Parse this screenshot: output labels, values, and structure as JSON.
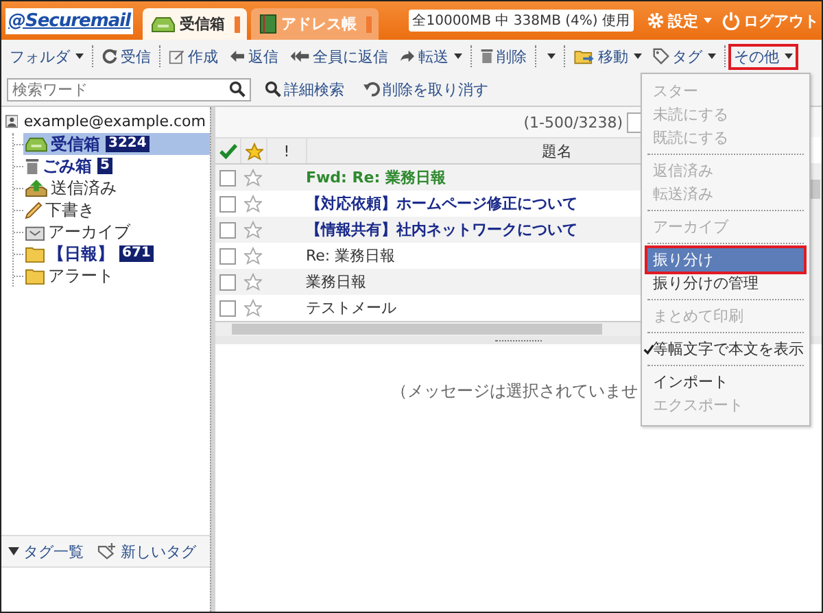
{
  "header": {
    "logo": "@Securemail",
    "tabs": [
      {
        "label": "受信箱",
        "kind": "inbox",
        "selected": true
      },
      {
        "label": "アドレス帳",
        "kind": "addressbook",
        "selected": false
      }
    ],
    "storage": "全10000MB 中 338MB (4%) 使用",
    "settings": "設定",
    "logout": "ログアウト"
  },
  "toolbar": [
    [
      {
        "label": "フォルダ",
        "kind": "plain",
        "dropdown": true,
        "highlighted": false
      }
    ],
    [
      {
        "label": "受信",
        "kind": "receive",
        "dropdown": false,
        "highlighted": false
      }
    ],
    [
      {
        "label": "作成",
        "kind": "compose",
        "dropdown": false,
        "highlighted": false
      },
      {
        "label": "返信",
        "kind": "reply",
        "dropdown": false,
        "highlighted": false
      },
      {
        "label": "全員に返信",
        "kind": "replyall",
        "dropdown": false,
        "highlighted": false
      },
      {
        "label": "転送",
        "kind": "forward",
        "dropdown": true,
        "highlighted": false
      }
    ],
    [
      {
        "label": "削除",
        "kind": "delete",
        "dropdown": false,
        "highlighted": false
      }
    ],
    [
      {
        "kind": "plain",
        "dropdown": true,
        "highlighted": false
      }
    ],
    [
      {
        "label": "移動",
        "kind": "move",
        "dropdown": true,
        "highlighted": false
      },
      {
        "label": "タグ",
        "kind": "tag",
        "dropdown": true,
        "highlighted": false
      }
    ],
    [
      {
        "label": "その他",
        "kind": "plain",
        "dropdown": true,
        "highlighted": true
      }
    ]
  ],
  "search": {
    "placeholder": "検索ワード",
    "advanced": "詳細検索",
    "undo": "削除を取り消す"
  },
  "sidebar": {
    "account": "example@example.com",
    "folders": [
      {
        "name": "受信箱",
        "kind": "inbox",
        "count": "3224",
        "selected": true
      },
      {
        "name": "ごみ箱",
        "kind": "trash",
        "count": "5",
        "selected": false
      },
      {
        "name": "送信済み",
        "kind": "sent",
        "selected": false
      },
      {
        "name": "下書き",
        "kind": "drafts",
        "selected": false
      },
      {
        "name": "アーカイブ",
        "kind": "archive",
        "selected": false
      },
      {
        "name": "【日報】",
        "kind": "folder",
        "count": "671",
        "selected": false
      },
      {
        "name": "アラート",
        "kind": "folder",
        "selected": false
      }
    ],
    "tag_list": "タグ一覧",
    "new_tag": "新しいタグ"
  },
  "messages": {
    "range": "(1-500/3238)",
    "columns": [
      "!",
      "題名"
    ],
    "rows": [
      {
        "subject": "Fwd: Re: 業務日報",
        "kind": "forwarded",
        "checked": false,
        "starred": false
      },
      {
        "subject": "【対応依頼】ホームページ修正について",
        "kind": "unread",
        "checked": false,
        "starred": false
      },
      {
        "subject": "【情報共有】社内ネットワークについて",
        "kind": "unread",
        "checked": false,
        "starred": false
      },
      {
        "subject": "Re: 業務日報",
        "kind": "read",
        "checked": false,
        "starred": false
      },
      {
        "subject": "業務日報",
        "kind": "read",
        "checked": false,
        "starred": false
      },
      {
        "subject": "テストメール",
        "kind": "read",
        "checked": false,
        "starred": false
      }
    ]
  },
  "preview": {
    "message": "（メッセージは選択されていませ"
  },
  "menu": {
    "groups": [
      [
        {
          "label": "スター",
          "disabled": true,
          "selected": false,
          "checked": false
        },
        {
          "label": "未読にする",
          "disabled": true,
          "selected": false,
          "checked": false
        },
        {
          "label": "既読にする",
          "disabled": true,
          "selected": false,
          "checked": false
        }
      ],
      [
        {
          "label": "返信済み",
          "disabled": true,
          "selected": false,
          "checked": false
        },
        {
          "label": "転送済み",
          "disabled": true,
          "selected": false,
          "checked": false
        }
      ],
      [
        {
          "label": "アーカイブ",
          "disabled": true,
          "selected": false,
          "checked": false
        }
      ],
      [
        {
          "label": "振り分け",
          "disabled": false,
          "selected": true,
          "checked": false
        },
        {
          "label": "振り分けの管理",
          "disabled": false,
          "selected": false,
          "checked": false
        }
      ],
      [
        {
          "label": "まとめて印刷",
          "disabled": true,
          "selected": false,
          "checked": false
        }
      ],
      [
        {
          "label": "等幅文字で本文を表示",
          "disabled": false,
          "selected": false,
          "checked": true
        }
      ],
      [
        {
          "label": "インポート",
          "disabled": false,
          "selected": false,
          "checked": false
        },
        {
          "label": "エクスポート",
          "disabled": true,
          "selected": false,
          "checked": false
        }
      ]
    ]
  }
}
